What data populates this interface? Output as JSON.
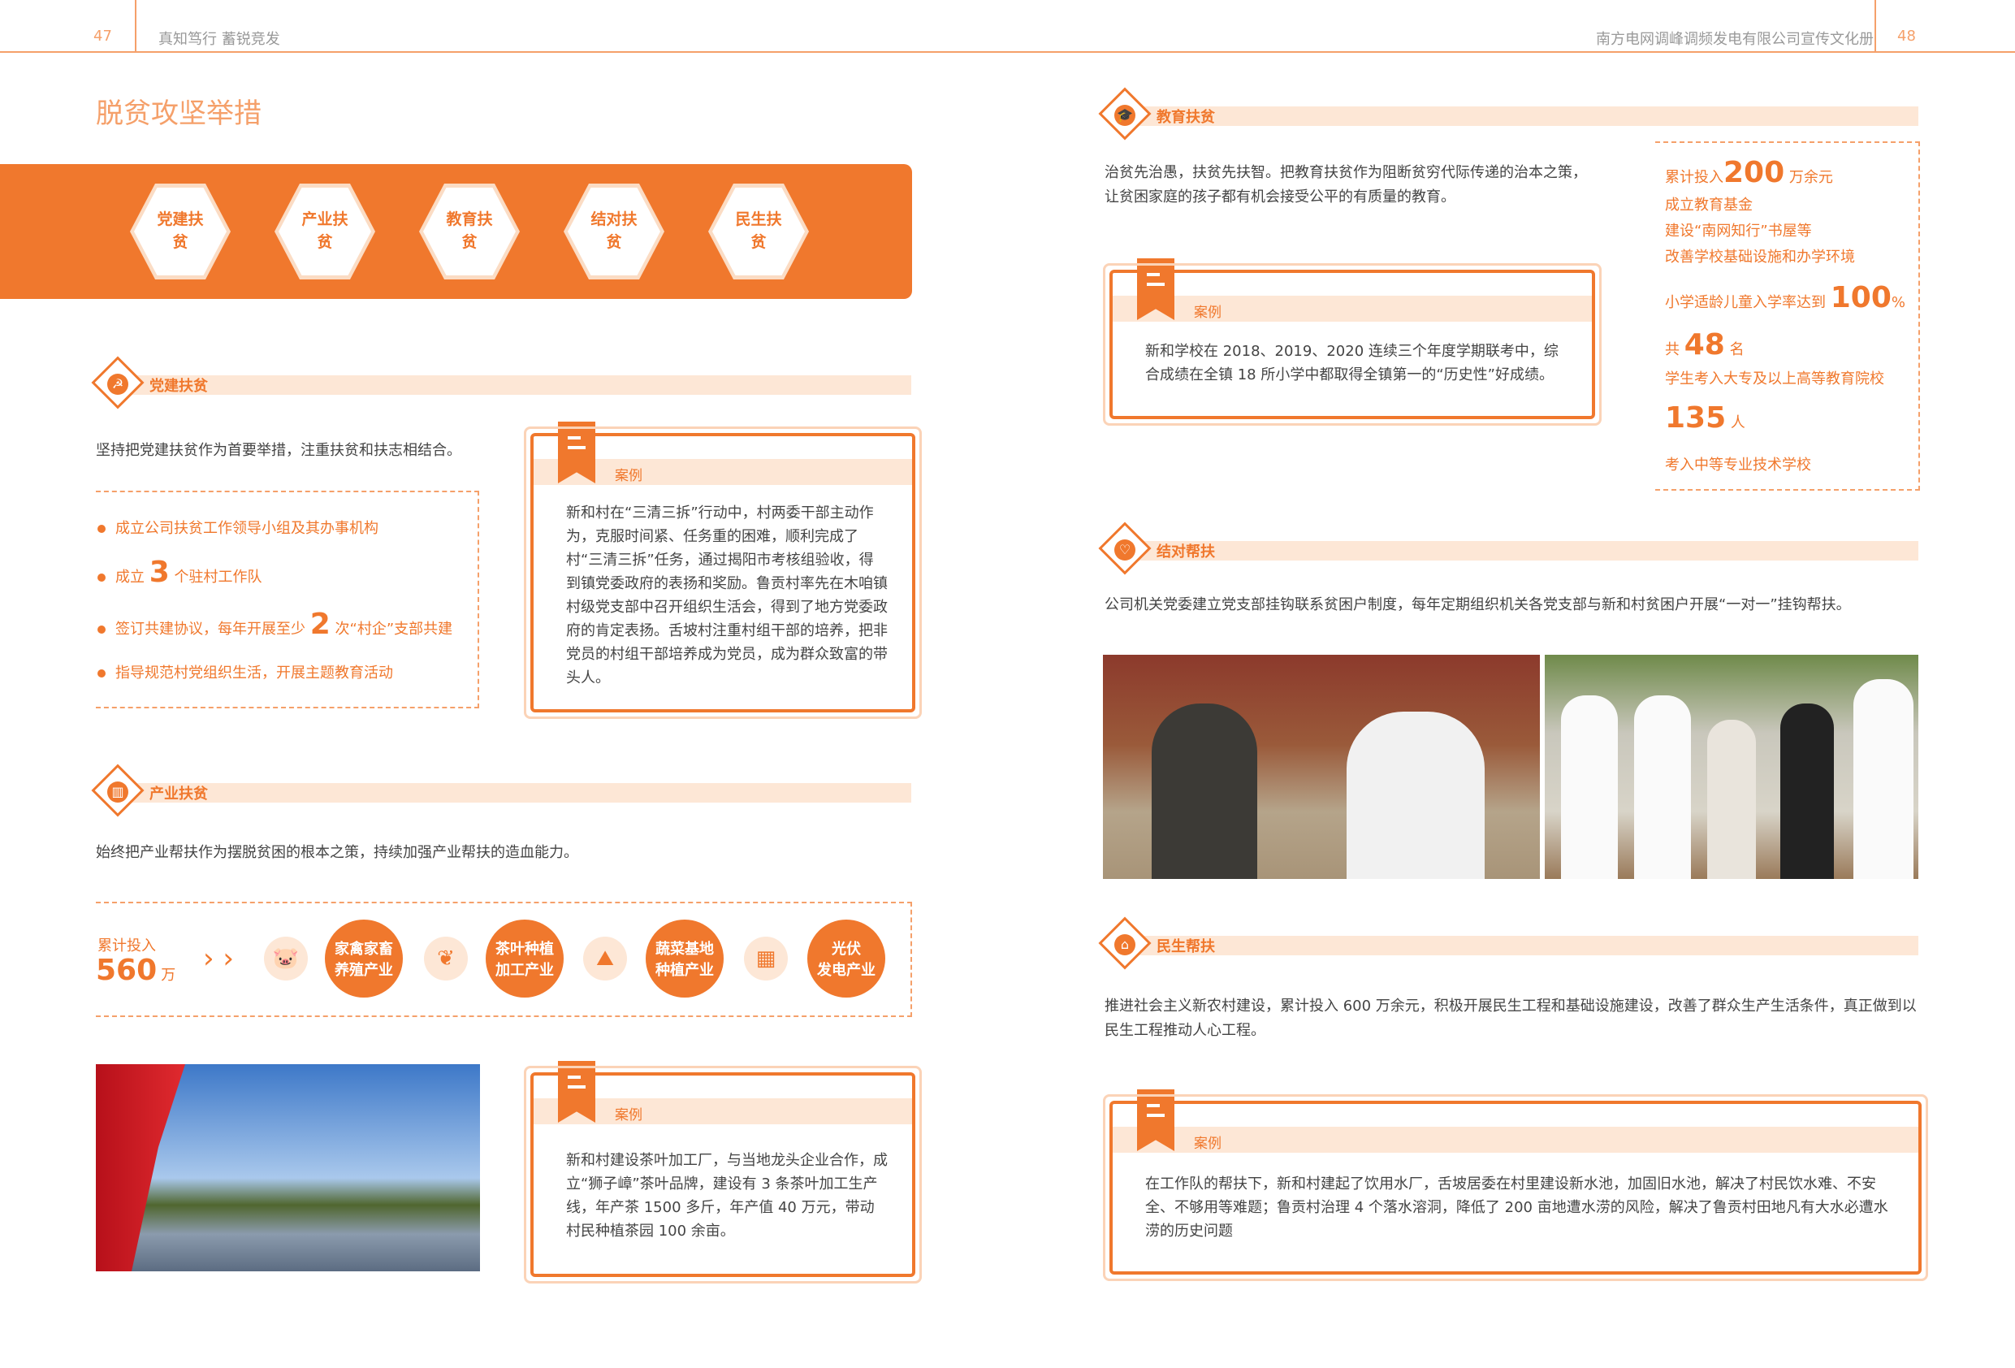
{
  "header": {
    "page_left": "47",
    "left_title": "真知笃行 蓄锐竞发",
    "right_title": "南方电网调峰调频发电有限公司宣传文化册",
    "page_right": "48"
  },
  "page_title": "脱贫攻坚举措",
  "measures": [
    "党建扶贫",
    "产业扶贫",
    "教育扶贫",
    "结对扶贫",
    "民生扶贫"
  ],
  "party": {
    "title": "党建扶贫",
    "intro": "坚持把党建扶贫作为首要举措，注重扶贫和扶志相结合。",
    "items": [
      {
        "pre": "成立公司扶贫工作领导小组及其办事机构",
        "num": "",
        "post": "",
        "num2": "",
        "post2": ""
      },
      {
        "pre": "成立",
        "num": "3",
        "post": "个驻村工作队",
        "num2": "",
        "post2": ""
      },
      {
        "pre": "签订共建协议，每年开展至少",
        "num": "2",
        "post": "次“村企”支部共建",
        "num2": "",
        "post2": ""
      },
      {
        "pre": "指导规范村党组织生活，开展主题教育活动",
        "num": "",
        "post": "",
        "num2": "",
        "post2": ""
      }
    ],
    "case_label": "案例",
    "case_text": "新和村在“三清三拆”行动中，村两委干部主动作为，克服时间紧、任务重的困难，顺利完成了村“三清三拆”任务，通过揭阳市考核组验收，得到镇党委政府的表扬和奖励。鲁贡村率先在木咱镇村级党支部中召开组织生活会，得到了地方党委政府的肯定表扬。舌坡村注重村组干部的培养，把非党员的村组干部培养成为党员，成为群众致富的带头人。"
  },
  "industry": {
    "title": "产业扶贫",
    "intro": "始终把产业帮扶作为摆脱贫困的根本之策，持续加强产业帮扶的造血能力。",
    "invest_label": "累计投入",
    "invest_value": "560",
    "invest_unit": "万",
    "arrows": "› ›",
    "items": [
      {
        "icon": "pig-icon",
        "line1": "家禽家畜",
        "line2": "养殖产业"
      },
      {
        "icon": "leaf-icon",
        "line1": "茶叶种植",
        "line2": "加工产业"
      },
      {
        "icon": "field-icon",
        "line1": "蔬菜基地",
        "line2": "种植产业"
      },
      {
        "icon": "solar-panel-icon",
        "line1": "光伏",
        "line2": "发电产业"
      }
    ],
    "case_label": "案例",
    "case_text": "新和村建设茶叶加工厂，与当地龙头企业合作，成立“狮子嶂”茶叶品牌，建设有 3 条茶叶加工生产线，年产茶 1500 多斤，年产值 40 万元，带动村民种植茶园 100 余亩。"
  },
  "education": {
    "title": "教育扶贫",
    "intro": "治贫先治愚，扶贫先扶智。把教育扶贫作为阻断贫穷代际传递的治本之策，让贫困家庭的孩子都有机会接受公平的有质量的教育。",
    "case_label": "案例",
    "case_text": "新和学校在 2018、2019、2020 连续三个年度学期联考中，综合成绩在全镇 18 所小学中都取得全镇第一的“历史性”好成绩。",
    "stats": {
      "invest_pre": "累计投入",
      "invest_num": "200",
      "invest_unit": "万余元",
      "line1": "成立教育基金",
      "line2": "建设“南网知行”书屋等",
      "line3": "改善学校基础设施和办学环境",
      "enroll_pre": "小学适龄儿童入学率达到",
      "enroll_num": "100",
      "enroll_unit": "%",
      "college_pre": "共",
      "college_num": "48",
      "college_unit": "名",
      "college_desc": "学生考入大专及以上高等教育院校",
      "voc_num": "135",
      "voc_unit": "人",
      "voc_desc": "考入中等专业技术学校"
    }
  },
  "pairing": {
    "title": "结对帮扶",
    "intro": "公司机关党委建立党支部挂钩联系贫困户制度，每年定期组织机关各党支部与新和村贫困户开展“一对一”挂钩帮扶。"
  },
  "livelihood": {
    "title": "民生帮扶",
    "intro": "推进社会主义新农村建设，累计投入 600 万余元，积极开展民生工程和基础设施建设，改善了群众生产生活条件，真正做到以民生工程推动人心工程。",
    "case_label": "案例",
    "case_text": "在工作队的帮扶下，新和村建起了饮用水厂，舌坡居委在村里建设新水池，加固旧水池，解决了村民饮水难、不安全、不够用等难题；鲁贡村治理 4 个落水溶洞，降低了 200 亩地遭水涝的风险，解决了鲁贡村田地凡有大水必遭水涝的历史问题"
  },
  "colors": {
    "accent": "#f0782d",
    "light": "#fde7d6"
  }
}
